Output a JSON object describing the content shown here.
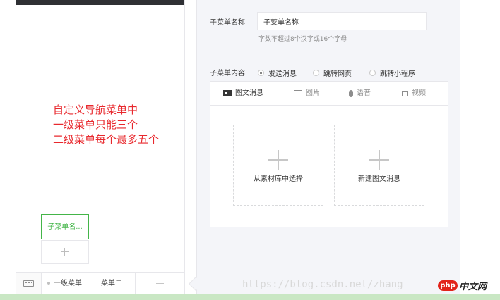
{
  "preview": {
    "annotation": "自定义导航菜单中\n一级菜单只能三个\n二级菜单每个最多五个",
    "sub_menu_active": "子菜单名...",
    "menu_items": [
      "一级菜单",
      "菜单二"
    ]
  },
  "editor": {
    "name_label": "子菜单名称",
    "name_value": "子菜单名称",
    "name_tip": "字数不超过8个汉字或16个字母",
    "content_label": "子菜单内容",
    "content_options": [
      {
        "label": "发送消息",
        "selected": true
      },
      {
        "label": "跳转网页",
        "selected": false
      },
      {
        "label": "跳转小程序",
        "selected": false
      }
    ],
    "tabs": [
      "图文消息",
      "图片",
      "语音",
      "视频"
    ],
    "cards": [
      "从素材库中选择",
      "新建图文消息"
    ]
  },
  "watermark": {
    "text": "https://blog.csdn.net/zhang",
    "logo": "php",
    "site": "中文网"
  },
  "colors": {
    "accent": "#44b549",
    "annotation": "#e8282d",
    "panel_bg": "#f4f5f9"
  }
}
